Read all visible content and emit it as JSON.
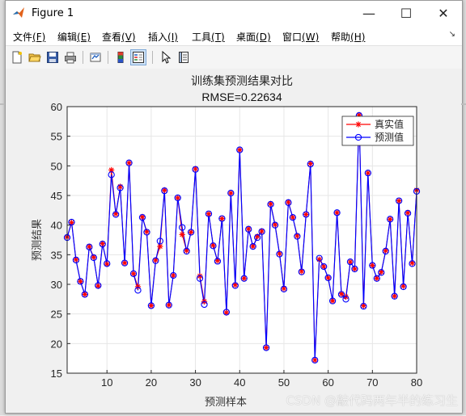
{
  "window": {
    "title": "Figure 1",
    "controls": {
      "minimize": "—",
      "maximize": "☐",
      "close": "✕"
    }
  },
  "menu": {
    "items": [
      {
        "label": "文件",
        "key": "(F)"
      },
      {
        "label": "编辑",
        "key": "(E)"
      },
      {
        "label": "查看",
        "key": "(V)"
      },
      {
        "label": "插入",
        "key": "(I)"
      },
      {
        "label": "工具",
        "key": "(T)"
      },
      {
        "label": "桌面",
        "key": "(D)"
      },
      {
        "label": "窗口",
        "key": "(W)"
      },
      {
        "label": "帮助",
        "key": "(H)"
      }
    ],
    "arrow": "↘"
  },
  "toolbar": {
    "icons": [
      "new-figure-icon",
      "open-file-icon",
      "save-icon",
      "print-icon",
      "link-plot-icon",
      "colorbar-icon",
      "legend-icon",
      "pointer-icon",
      "property-inspector-icon"
    ]
  },
  "colors": {
    "true_series": "#ff0000",
    "pred_series": "#0000ff",
    "axes_bg": "#ffffff",
    "grid": "#e6e6e6"
  },
  "watermark": "CSDN @敲代码两年半的练习生",
  "chart_data": {
    "type": "line",
    "title": "训练集预测结果对比",
    "subtitle": "RMSE=0.22634",
    "xlabel": "预测样本",
    "ylabel": "预测结果",
    "xlim": [
      1,
      80
    ],
    "ylim": [
      15,
      60
    ],
    "xticks": [
      10,
      20,
      30,
      40,
      50,
      60,
      70,
      80
    ],
    "yticks": [
      15,
      20,
      25,
      30,
      35,
      40,
      45,
      50,
      55,
      60
    ],
    "grid": true,
    "legend_position": "top-right",
    "x": [
      1,
      2,
      3,
      4,
      5,
      6,
      7,
      8,
      9,
      10,
      11,
      12,
      13,
      14,
      15,
      16,
      17,
      18,
      19,
      20,
      21,
      22,
      23,
      24,
      25,
      26,
      27,
      28,
      29,
      30,
      31,
      32,
      33,
      34,
      35,
      36,
      37,
      38,
      39,
      40,
      41,
      42,
      43,
      44,
      45,
      46,
      47,
      48,
      49,
      50,
      51,
      52,
      53,
      54,
      55,
      56,
      57,
      58,
      59,
      60,
      61,
      62,
      63,
      64,
      65,
      66,
      67,
      68,
      69,
      70,
      71,
      72,
      73,
      74,
      75,
      76,
      77,
      78,
      79,
      80
    ],
    "series": [
      {
        "name": "真实值",
        "marker": "*",
        "color": "#ff0000",
        "values": [
          38,
          40.4,
          34.2,
          30.5,
          28.3,
          36.4,
          34.6,
          29.7,
          36.9,
          33.4,
          49.3,
          41.9,
          46.5,
          33.6,
          50.5,
          31.8,
          29.6,
          41.4,
          38.9,
          26.4,
          34.1,
          36.4,
          45.9,
          26.5,
          31.5,
          44.6,
          38.4,
          35.7,
          38.8,
          49.5,
          31.4,
          27.1,
          41.9,
          36.6,
          34.0,
          41.1,
          25.2,
          45.4,
          29.9,
          52.7,
          31.0,
          39.4,
          36.4,
          38.1,
          39.0,
          19.3,
          43.6,
          40.1,
          35.2,
          29.3,
          43.9,
          41.3,
          38.2,
          32.2,
          41.8,
          50.4,
          17.2,
          34.2,
          33.0,
          31.1,
          27.2,
          42.1,
          28.4,
          27.9,
          33.8,
          32.6,
          58.6,
          26.4,
          48.8,
          33.2,
          31.0,
          32.1,
          35.7,
          41.0,
          28.0,
          44.1,
          29.7,
          42.1,
          33.6,
          45.9
        ]
      },
      {
        "name": "预测值",
        "marker": "o",
        "color": "#0000ff",
        "values": [
          37.9,
          40.5,
          34.1,
          30.5,
          28.3,
          36.3,
          34.5,
          29.8,
          36.8,
          33.5,
          48.5,
          41.8,
          46.3,
          33.6,
          50.5,
          31.8,
          29.0,
          41.3,
          38.8,
          26.4,
          34.0,
          37.3,
          45.8,
          26.5,
          31.5,
          44.6,
          39.6,
          35.6,
          38.8,
          49.4,
          31.0,
          26.6,
          41.9,
          36.5,
          33.9,
          41.1,
          25.3,
          45.4,
          29.8,
          52.7,
          31.0,
          39.3,
          36.4,
          37.9,
          38.9,
          19.3,
          43.5,
          40.0,
          35.1,
          29.2,
          43.8,
          41.3,
          38.1,
          32.1,
          41.8,
          50.3,
          17.2,
          34.4,
          33.0,
          31.1,
          27.2,
          42.1,
          28.3,
          27.5,
          33.8,
          32.6,
          58.5,
          26.3,
          48.8,
          33.2,
          31.0,
          32.0,
          35.6,
          41.0,
          28.0,
          44.1,
          29.6,
          42.0,
          33.5,
          45.7
        ]
      }
    ]
  }
}
